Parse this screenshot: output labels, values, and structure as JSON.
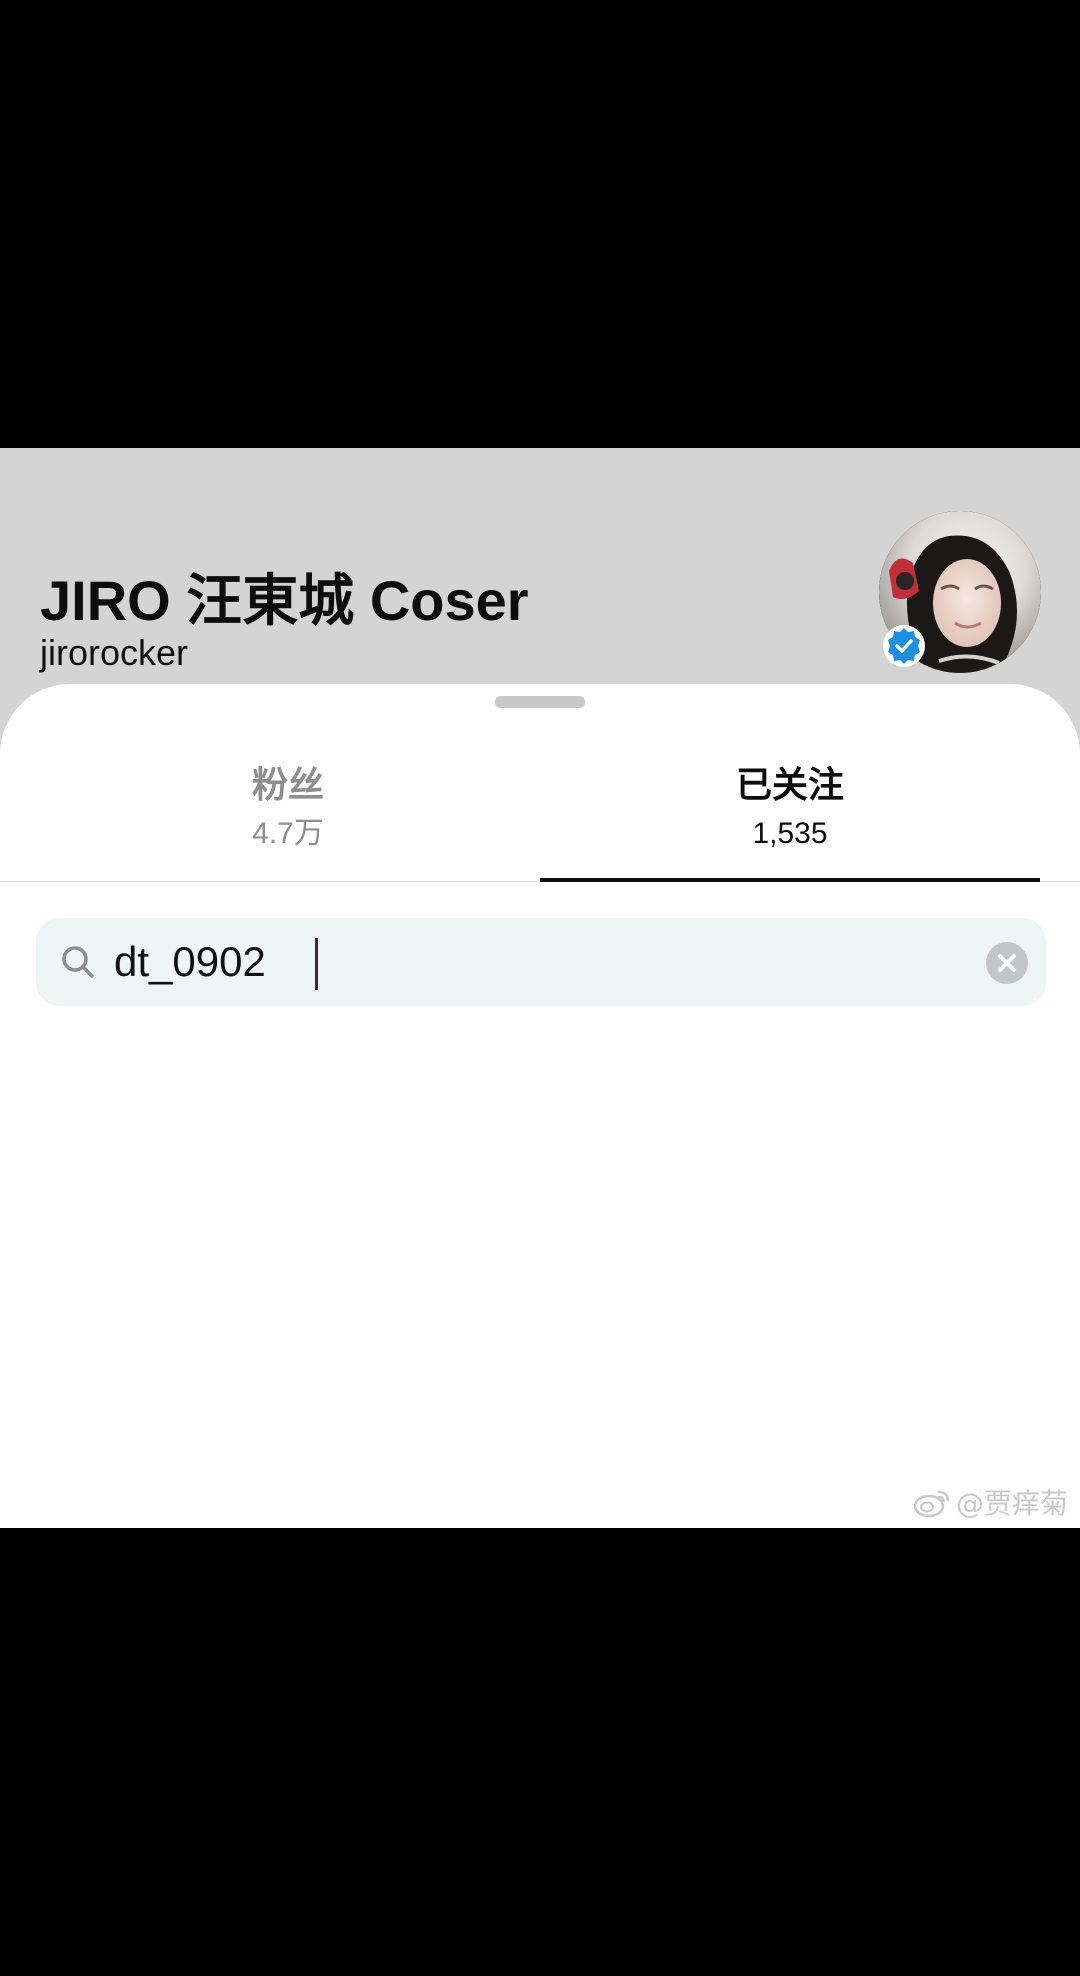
{
  "profile": {
    "display_name": "JIRO 汪東城 Coser",
    "handle": "jirorocker",
    "verified": true
  },
  "tabs": [
    {
      "title": "粉丝",
      "count": "4.7万",
      "active": false
    },
    {
      "title": "已关注",
      "count": "1,535",
      "active": true
    }
  ],
  "search": {
    "value": "dt_0902",
    "icon": "search-icon",
    "clear_icon": "clear-icon"
  },
  "watermark": {
    "text": "@贾痒菊",
    "icon": "weibo-icon"
  },
  "colors": {
    "header_bg": "#d4d4d4",
    "sheet_bg": "#ffffff",
    "search_bg": "#eef5f5",
    "verified_badge": "#1d8fe0",
    "inactive_tab": "#8e8e8e",
    "active_tab": "#0b0b0b"
  }
}
